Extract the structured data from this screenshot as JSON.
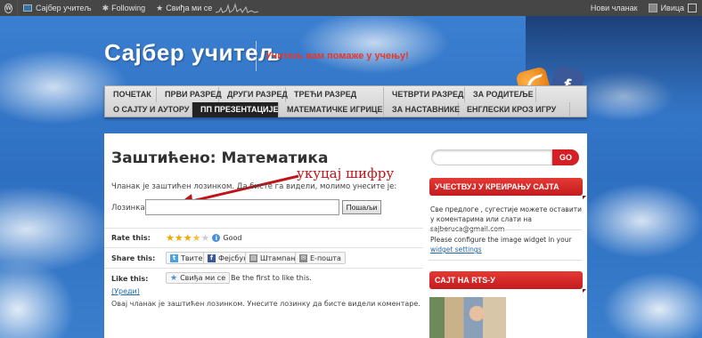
{
  "adminbar": {
    "site_name": "Сајбер учитељ",
    "following": "Following",
    "like": "Свиђа ми се",
    "new_post": "Нови чланак",
    "user": "Ивица"
  },
  "header": {
    "title": "Сајбер учитељ",
    "tagline": "Учитељ вам помаже у учењу!"
  },
  "nav": {
    "row1": [
      "ПОЧЕТАК",
      "ПРВИ РАЗРЕД",
      "ДРУГИ РАЗРЕД",
      "ТРЕЋИ РАЗРЕД",
      "ЧЕТВРТИ РАЗРЕД",
      "ЗА РОДИТЕЉЕ"
    ],
    "row2": [
      "О САЈТУ И АУТОРУ",
      "ПП ПРЕЗЕНТАЦИЈЕ",
      "МАТЕМАТИЧКЕ ИГРИЦЕ",
      "ЗА НАСТАВНИКЕ",
      "ЕНГЛЕСКИ КРОЗ ИГРУ"
    ],
    "active": "ПП ПРЕЗЕНТАЦИЈЕ"
  },
  "post": {
    "title": "Заштићено: Математика",
    "annotation": "укуцај шифру",
    "protected_note": "Чланак је заштићен лозинком. Да бисте га видели, молимо унесите је:",
    "password_label": "Лозинка:",
    "password_value": "",
    "submit_label": "Пошаљи",
    "rate_label": "Rate this:",
    "rating_text": "Good",
    "rating_stars": 3.5,
    "share_label": "Share this:",
    "share_buttons": [
      "Твитер",
      "Фејсбук",
      "Штампање",
      "Е-пошта"
    ],
    "like_label": "Like this:",
    "like_button": "Свиђа ми се",
    "like_text": "Be the first to like this.",
    "edit_link": "(Уреди)",
    "protected_comments": "Овај чланак је заштићен лозинком. Унесите лозинку да бисте видели коментаре."
  },
  "sidebar": {
    "search_button": "GO",
    "widget1_title": "УЧЕСТВУЈ У КРЕИРАЊУ САЈТА",
    "widget1_text": "Све предлоге , сугестије можете оставити у коментарима или слати на sajberuca@gmail.com",
    "widget2_text_pre": "Please configure the image widget in your",
    "widget2_link": "widget settings",
    "widget3_title": "САЈТ НА RTS-У"
  },
  "colors": {
    "accent_red": "#d32027",
    "tagline_red": "#e4392b",
    "adminbar_bg": "#464646"
  }
}
